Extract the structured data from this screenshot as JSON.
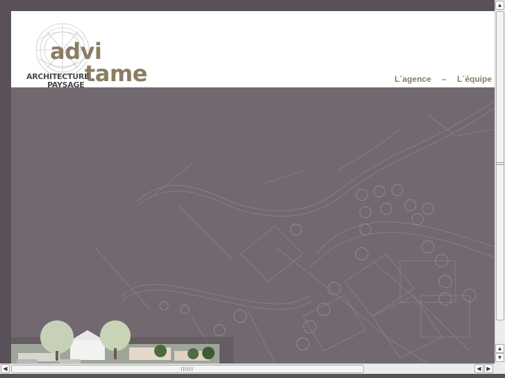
{
  "brand": {
    "word1": "advi",
    "word2": "tame",
    "tag1": "ARCHITECTURE",
    "tag2": "PAYSAGE",
    "color": "#8a7d62"
  },
  "nav": {
    "items": [
      {
        "label": "L´agence"
      },
      {
        "label": "L´équipe"
      }
    ],
    "separator": "–"
  },
  "colors": {
    "background": "#726870",
    "frame": "#5a5059",
    "header": "#ffffff",
    "accent": "#8a7d62"
  },
  "icons": {
    "scroll_up": "arrow-up-icon",
    "scroll_down": "arrow-down-icon",
    "scroll_left": "arrow-left-icon",
    "scroll_right": "arrow-right-icon"
  }
}
